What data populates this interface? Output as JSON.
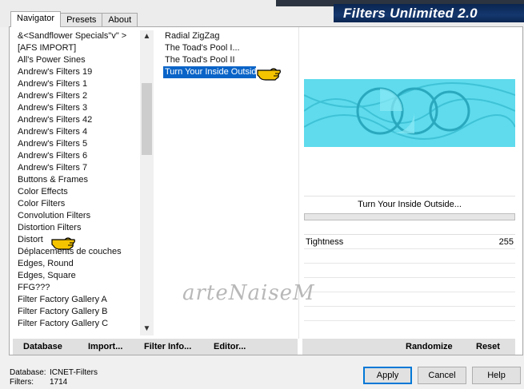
{
  "app": {
    "title": "Filters Unlimited 2.0"
  },
  "tabs": [
    {
      "label": "Navigator"
    },
    {
      "label": "Presets"
    },
    {
      "label": "About"
    }
  ],
  "categories": [
    "&<Sandflower Specials\"v\" >",
    "[AFS IMPORT]",
    "All's Power Sines",
    "Andrew's Filters 19",
    "Andrew's Filters 1",
    "Andrew's Filters 2",
    "Andrew's Filters 3",
    "Andrew's Filters 42",
    "Andrew's Filters 4",
    "Andrew's Filters 5",
    "Andrew's Filters 6",
    "Andrew's Filters 7",
    "Buttons & Frames",
    "Color Effects",
    "Color Filters",
    "Convolution Filters",
    "Distortion Filters",
    "Distort",
    "Déplacements de couches",
    "Edges, Round",
    "Edges, Square",
    "FFG???",
    "Filter Factory Gallery A",
    "Filter Factory Gallery B",
    "Filter Factory Gallery C"
  ],
  "filters": [
    "Radial ZigZag",
    "The Toad's Pool I...",
    "The Toad's Pool II",
    "Turn Your Inside Outside..."
  ],
  "selected_filter": "Turn Your Inside Outside...",
  "parameter": {
    "label": "Tightness",
    "value": "255"
  },
  "watermark": "arteNaiseM",
  "toolbar": {
    "database": "Database",
    "import": "Import...",
    "filter_info": "Filter Info...",
    "editor": "Editor...",
    "randomize": "Randomize",
    "reset": "Reset"
  },
  "status": {
    "database_label": "Database:",
    "database_value": "ICNET-Filters",
    "filters_label": "Filters:",
    "filters_value": "1714"
  },
  "buttons": {
    "apply": "Apply",
    "cancel": "Cancel",
    "help": "Help"
  },
  "colors": {
    "preview_cyan": "#5fdbed",
    "selection_blue": "#0a64c8",
    "title_navy": "#0a2550"
  }
}
